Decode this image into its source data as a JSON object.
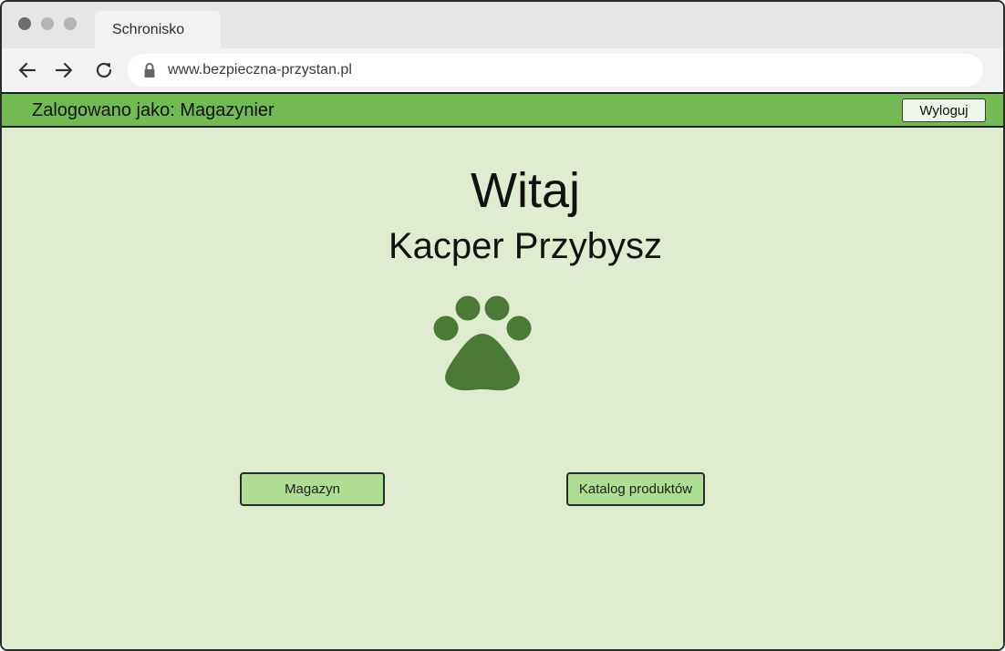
{
  "browser": {
    "tab_title": "Schronisko",
    "url": "www.bezpieczna-przystan.pl"
  },
  "header": {
    "login_info": "Zalogowano jako: Magazynier",
    "logout_label": "Wyloguj",
    "color": "#72bb53"
  },
  "main": {
    "greeting": "Witaj",
    "user_name": "Kacper Przybysz",
    "logo_icon": "paw-icon",
    "logo_color": "#4a7a34",
    "buttons": {
      "warehouse_label": "Magazyn",
      "catalog_label": "Katalog produktów"
    },
    "background": "#dfeccf"
  }
}
